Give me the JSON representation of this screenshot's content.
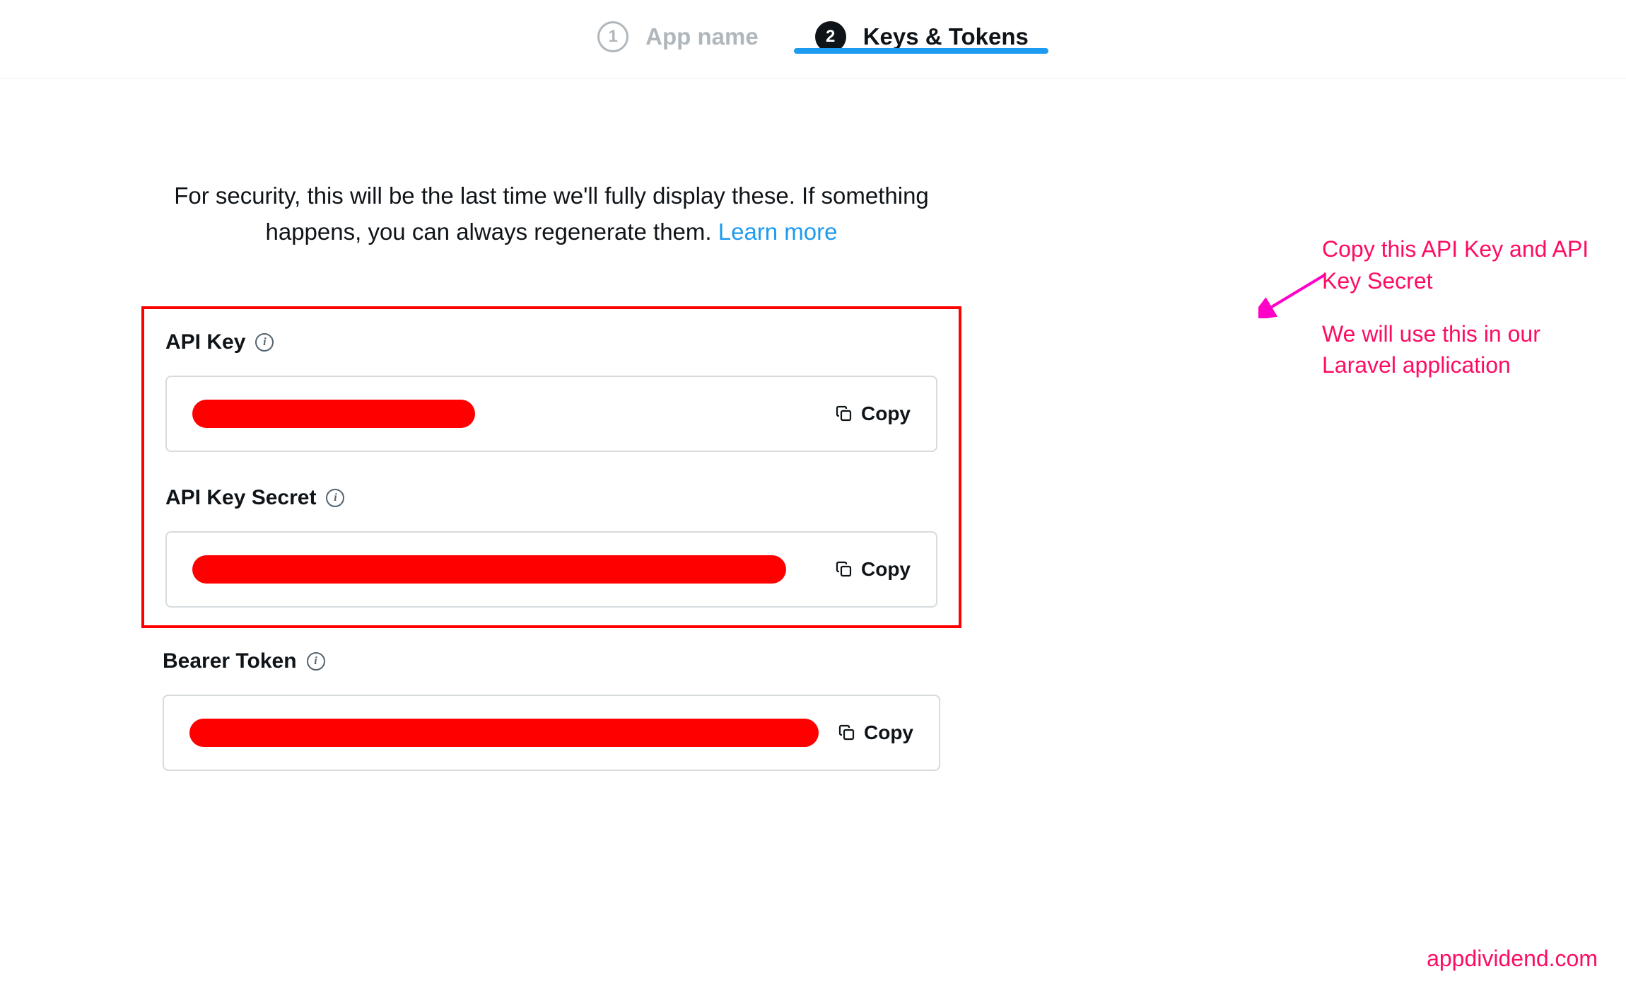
{
  "stepper": {
    "steps": [
      {
        "num": "1",
        "label": "App name"
      },
      {
        "num": "2",
        "label": "Keys & Tokens"
      }
    ]
  },
  "security": {
    "text_prefix": "For security, this will be the last time we'll fully display these. If something happens, you can always regenerate them. ",
    "learn_more": "Learn more"
  },
  "keys": {
    "api_key_label": "API Key",
    "api_key_secret_label": "API Key Secret",
    "bearer_token_label": "Bearer Token",
    "copy_label": "Copy"
  },
  "annotation": {
    "line1": "Copy this API Key and API Key Secret",
    "line2": "We will use this in our Laravel application"
  },
  "watermark": "appdividend.com"
}
